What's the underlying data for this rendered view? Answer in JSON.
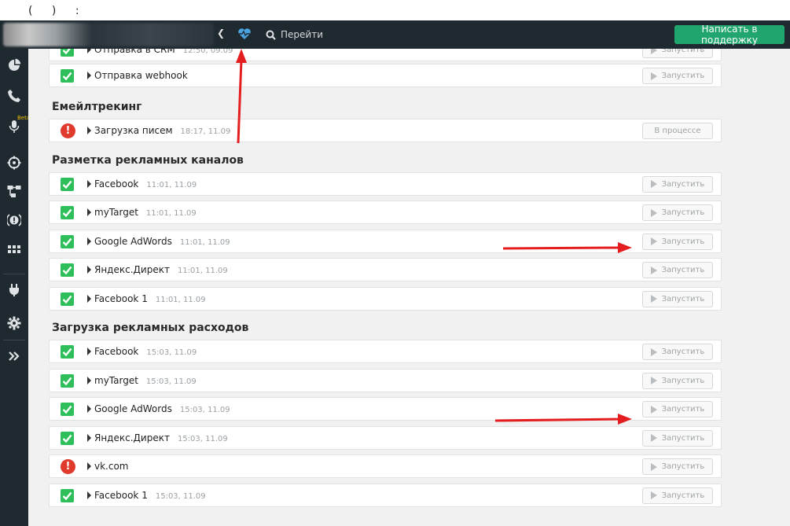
{
  "caption": "( ) :",
  "topbar": {
    "go_label": "Перейти",
    "support_label": "Написать в поддержку",
    "accent": "#21a56e",
    "heart_color": "#4aa3e0"
  },
  "sidebar": {
    "beta": "Beta"
  },
  "top_rows": [
    {
      "label": "Отправка в CRM",
      "time": "12:50, 09.09",
      "status": "ok",
      "action": "Запустить"
    },
    {
      "label": "Отправка webhook",
      "time": "",
      "status": "ok",
      "action": "Запустить"
    }
  ],
  "sections": [
    {
      "title": "Емейлтрекинг",
      "rows": [
        {
          "label": "Загрузка писем",
          "time": "18:17, 11.09",
          "status": "error",
          "action": "В процессе"
        }
      ]
    },
    {
      "title": "Разметка рекламных каналов",
      "rows": [
        {
          "label": "Facebook",
          "time": "11:01, 11.09",
          "status": "ok",
          "action": "Запустить"
        },
        {
          "label": "myTarget",
          "time": "11:01, 11.09",
          "status": "ok",
          "action": "Запустить"
        },
        {
          "label": "Google AdWords",
          "time": "11:01, 11.09",
          "status": "ok",
          "action": "Запустить"
        },
        {
          "label": "Яндекс.Директ",
          "time": "11:01, 11.09",
          "status": "ok",
          "action": "Запустить"
        },
        {
          "label": "Facebook 1",
          "time": "11:01, 11.09",
          "status": "ok",
          "action": "Запустить"
        }
      ]
    },
    {
      "title": "Загрузка рекламных расходов",
      "rows": [
        {
          "label": "Facebook",
          "time": "15:03, 11.09",
          "status": "ok",
          "action": "Запустить"
        },
        {
          "label": "myTarget",
          "time": "15:03, 11.09",
          "status": "ok",
          "action": "Запустить"
        },
        {
          "label": "Google AdWords",
          "time": "15:03, 11.09",
          "status": "ok",
          "action": "Запустить"
        },
        {
          "label": "Яндекс.Директ",
          "time": "15:03, 11.09",
          "status": "ok",
          "action": "Запустить"
        },
        {
          "label": "vk.com",
          "time": "",
          "status": "error",
          "action": "Запустить"
        },
        {
          "label": "Facebook 1",
          "time": "15:03, 11.09",
          "status": "ok",
          "action": "Запустить"
        }
      ]
    }
  ],
  "annotation_color": "#e41e1e"
}
